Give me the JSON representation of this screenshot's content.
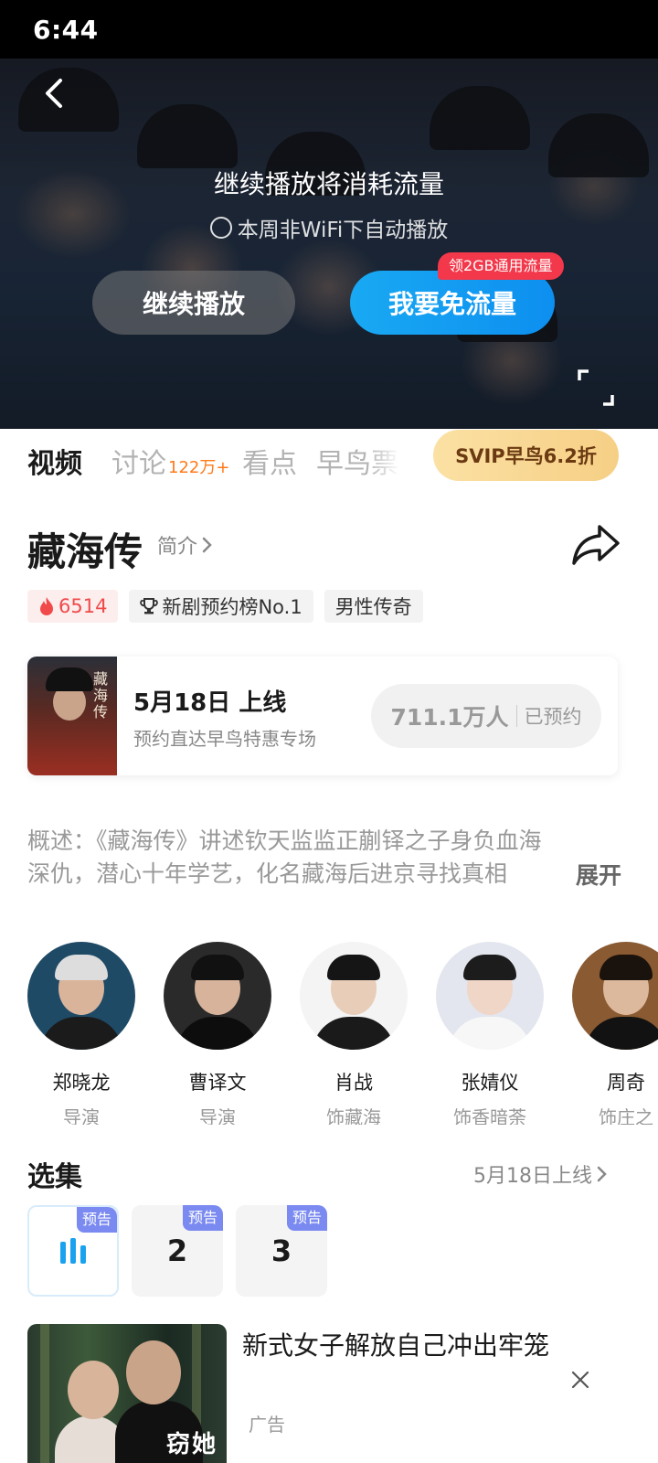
{
  "status_bar": {
    "time": "6:44"
  },
  "player": {
    "message": "继续播放将消耗流量",
    "auto_play_option": "本周非WiFi下自动播放",
    "continue_label": "继续播放",
    "free_data_label": "我要免流量",
    "free_data_badge": "领2GB通用流量"
  },
  "tabs": [
    {
      "label": "视频"
    },
    {
      "label": "讨论",
      "count": "122万+"
    },
    {
      "label": "看点"
    },
    {
      "label": "早鸟票"
    }
  ],
  "svip_button": "SVIP早鸟6.2折",
  "show": {
    "title": "藏海传",
    "intro_link": "简介",
    "tags": [
      {
        "label": "6514",
        "icon": "flame-icon"
      },
      {
        "label": "新剧预约榜No.1",
        "icon": "trophy-icon"
      },
      {
        "label": "男性传奇"
      }
    ]
  },
  "release": {
    "poster_title": "藏海传",
    "date": "5月18日 上线",
    "subtitle": "预约直达早鸟特惠专场",
    "reserved_count": "711.1万人",
    "reserved_label": "已预约"
  },
  "synopsis": {
    "line1": "概述：《藏海传》讲述钦天监监正蒯铎之子身负血海",
    "line2": "深仇，潜心十年学艺，化名藏海后进京寻找真相",
    "expand": "展开"
  },
  "cast": [
    {
      "name": "郑晓龙",
      "role": "导演"
    },
    {
      "name": "曹译文",
      "role": "导演"
    },
    {
      "name": "肖战",
      "role": "饰藏海"
    },
    {
      "name": "张婧仪",
      "role": "饰香暗荼"
    },
    {
      "name": "周奇",
      "role": "饰庄之"
    }
  ],
  "episodes": {
    "title": "选集",
    "more": "5月18日上线",
    "items": [
      {
        "label": "",
        "badge": "预告"
      },
      {
        "label": "2",
        "badge": "预告"
      },
      {
        "label": "3",
        "badge": "预告"
      }
    ]
  },
  "ad": {
    "title": "新式女子解放自己冲出牢笼",
    "label": "广告",
    "image_logo": "窃她"
  },
  "colors": {
    "accent_blue": "#1aa2ee",
    "svip_gold": "#f6cf85",
    "badge_red": "#f2384a",
    "count_orange": "#ff7a1a",
    "trailer_badge": "#7a8af0"
  }
}
